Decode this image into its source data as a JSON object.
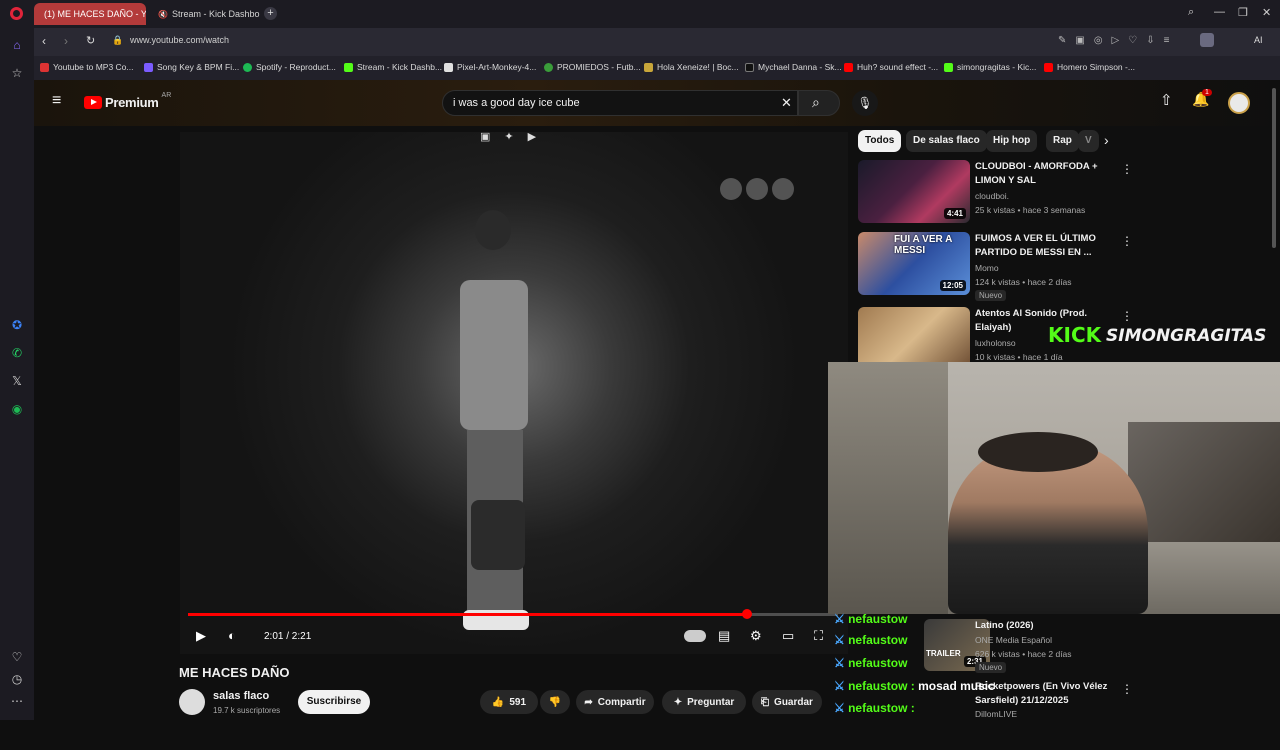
{
  "browser": {
    "tabs": [
      {
        "label": "(1) ME HACES DAÑO - Yo",
        "active": true
      },
      {
        "label": "Stream - Kick Dashbo",
        "active": false
      }
    ],
    "url": "www.youtube.com/watch",
    "bookmarks": [
      {
        "label": "Youtube to MP3 Co...",
        "color": "#d33"
      },
      {
        "label": "Song Key & BPM Fi...",
        "color": "#7b5cff"
      },
      {
        "label": "Spotify - Reproduct...",
        "color": "#1db954"
      },
      {
        "label": "Stream - Kick Dashb...",
        "color": "#53fc18"
      },
      {
        "label": "Pixel-Art-Monkey-4...",
        "color": "#e0e0e0"
      },
      {
        "label": "PROMIEDOS - Futb...",
        "color": "#3a9d3a"
      },
      {
        "label": "Hola Xeneize! | Boc...",
        "color": "#c8a63a"
      },
      {
        "label": "Mychael Danna - Sk...",
        "color": "#111"
      },
      {
        "label": "Huh? sound effect -...",
        "color": "#f00"
      },
      {
        "label": "simongragitas - Kic...",
        "color": "#53fc18"
      },
      {
        "label": "Homero Simpson -...",
        "color": "#f00"
      }
    ],
    "ai_label": "AI"
  },
  "youtube": {
    "logo_text": "Premium",
    "region": "AR",
    "search_query": "i was a good day ice cube",
    "notification_count": "1",
    "chips": [
      "Todos",
      "De salas flaco",
      "Hip hop",
      "Rap",
      "V"
    ],
    "player": {
      "time": "2:01 / 2:21",
      "progress": 0.86
    },
    "video_title": "ME HACES DAÑO",
    "channel_name": "salas flaco",
    "channel_subs": "19.7 k suscriptores",
    "subscribe_label": "Suscribirse",
    "likes": "591",
    "share_label": "Compartir",
    "ask_label": "Preguntar",
    "save_label": "Guardar",
    "related": [
      {
        "title": "CLOUDBOI - AMORFODA + LIMON Y SAL",
        "channel": "cloudboi.",
        "meta": "25 k vistas • hace 3 semanas",
        "duration": "4:41",
        "new": ""
      },
      {
        "title": "FUIMOS A VER EL ÚLTIMO PARTIDO DE MESSI EN ...",
        "channel": "Momo",
        "meta": "124 k vistas • hace 2 días",
        "duration": "12:05",
        "new": "Nuevo",
        "thumb_text": "FUI A VER A MESSI"
      },
      {
        "title": "Atentos Al Sonido (Prod. Elaiyah)",
        "channel": "luxholonso",
        "meta": "10 k vistas • hace 1 día",
        "duration": "",
        "new": ""
      },
      {
        "title": "Latino (2026)",
        "channel": "ONE Media Español",
        "meta": "626 k vistas • hace 2 días",
        "duration": "2:31",
        "new": "Nuevo",
        "thumb_text": "TRAILER"
      },
      {
        "title": "Rocketpowers (En Vivo Vélez Sarsfield) 21/12/2025",
        "channel": "DillomLIVE",
        "meta": "",
        "duration": "",
        "new": ""
      }
    ]
  },
  "stream_overlay": {
    "kick_logo": "KICK",
    "streamer": "SIMONGRAGITAS",
    "chat": [
      {
        "user": "nefaustow",
        "msg": ""
      },
      {
        "user": "nefaustow",
        "msg": ""
      },
      {
        "user": "nefaustow",
        "msg": ""
      },
      {
        "user": "nefaustow :",
        "msg": "mosad music"
      },
      {
        "user": "nefaustow :",
        "msg": ""
      }
    ]
  }
}
